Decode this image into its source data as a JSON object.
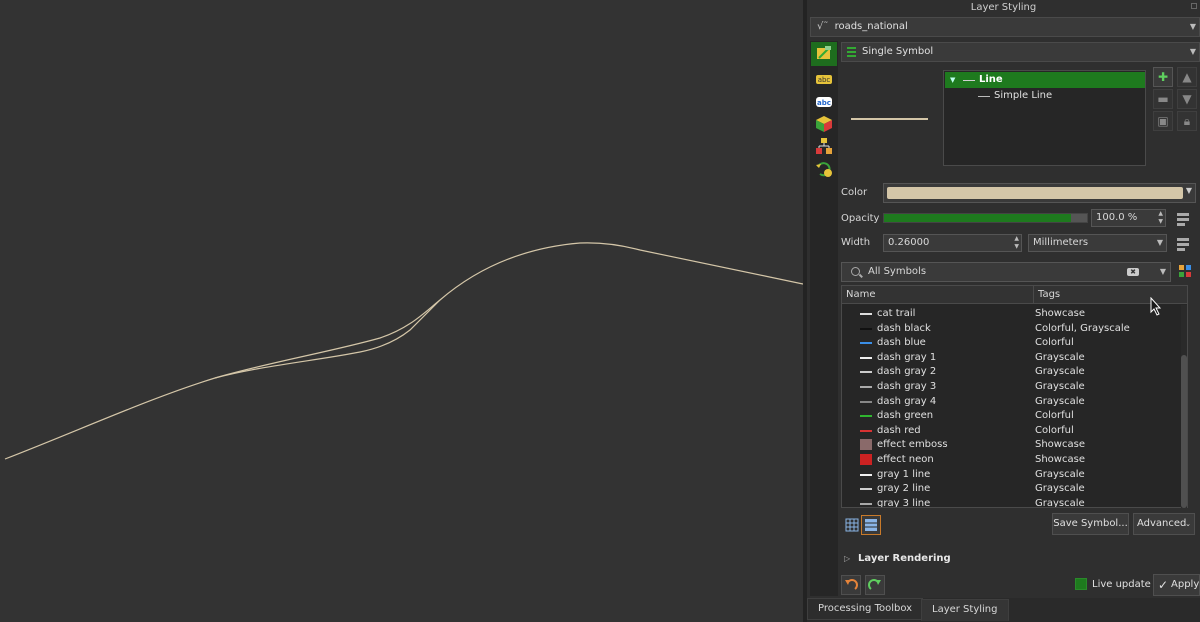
{
  "panel": {
    "title": "Layer Styling",
    "layer_name": "roads_national"
  },
  "sidebar": {
    "items": [
      {
        "name": "symbology",
        "icon": "paintbrush-icon",
        "active": true
      },
      {
        "name": "labels",
        "icon": "labels-abc-icon"
      },
      {
        "name": "masks",
        "icon": "mask-abc-icon"
      },
      {
        "name": "3d-view",
        "icon": "3d-cube-icon"
      },
      {
        "name": "diagrams",
        "icon": "diagram-icon"
      },
      {
        "name": "history",
        "icon": "history-icon"
      }
    ]
  },
  "renderer": {
    "selected": "Single Symbol"
  },
  "symbol_tree": {
    "root": "Line",
    "child": "Simple Line"
  },
  "properties": {
    "color_label": "Color",
    "color_value": "#d4c6a8",
    "opacity_label": "Opacity",
    "opacity_percent": 100,
    "opacity_value": "100.0 %",
    "width_label": "Width",
    "width_value": "0.26000",
    "width_unit": "Millimeters"
  },
  "library": {
    "search_placeholder": "All Symbols",
    "columns": {
      "name": "Name",
      "tags": "Tags"
    },
    "rows": [
      {
        "name": "cat trail",
        "tags": "Showcase",
        "swatch": "#dddddd"
      },
      {
        "name": "dash  black",
        "tags": "Colorful, Grayscale",
        "swatch": "#111111"
      },
      {
        "name": "dash blue",
        "tags": "Colorful",
        "swatch": "#3a8ee6"
      },
      {
        "name": "dash gray 1",
        "tags": "Grayscale",
        "swatch": "#eeeeee"
      },
      {
        "name": "dash gray 2",
        "tags": "Grayscale",
        "swatch": "#cccccc"
      },
      {
        "name": "dash gray 3",
        "tags": "Grayscale",
        "swatch": "#aaaaaa"
      },
      {
        "name": "dash gray 4",
        "tags": "Grayscale",
        "swatch": "#888888"
      },
      {
        "name": "dash green",
        "tags": "Colorful",
        "swatch": "#2fb52f"
      },
      {
        "name": "dash red",
        "tags": "Colorful",
        "swatch": "#d83232"
      },
      {
        "name": "effect emboss",
        "tags": "Showcase",
        "swatch": "#8a6a6a"
      },
      {
        "name": "effect neon",
        "tags": "Showcase",
        "swatch": "#cc2222"
      },
      {
        "name": "gray 1 line",
        "tags": "Grayscale",
        "swatch": "#f0f0f0"
      },
      {
        "name": "gray 2 line",
        "tags": "Grayscale",
        "swatch": "#cfcfcf"
      },
      {
        "name": "gray 3 line",
        "tags": "Grayscale",
        "swatch": "#a8a8a8"
      }
    ],
    "save_button": "Save Symbol...",
    "advanced_button": "Advanced"
  },
  "layer_rendering": "Layer Rendering",
  "footer": {
    "live_update": "Live update",
    "live_update_checked": true,
    "apply": "Apply"
  },
  "tabs": [
    "Processing Toolbox",
    "Layer Styling"
  ],
  "active_tab": "Layer Styling",
  "colors": {
    "accent_green": "#1e7a1e",
    "line_color": "#d4c6a8",
    "map_background": "#333333"
  }
}
